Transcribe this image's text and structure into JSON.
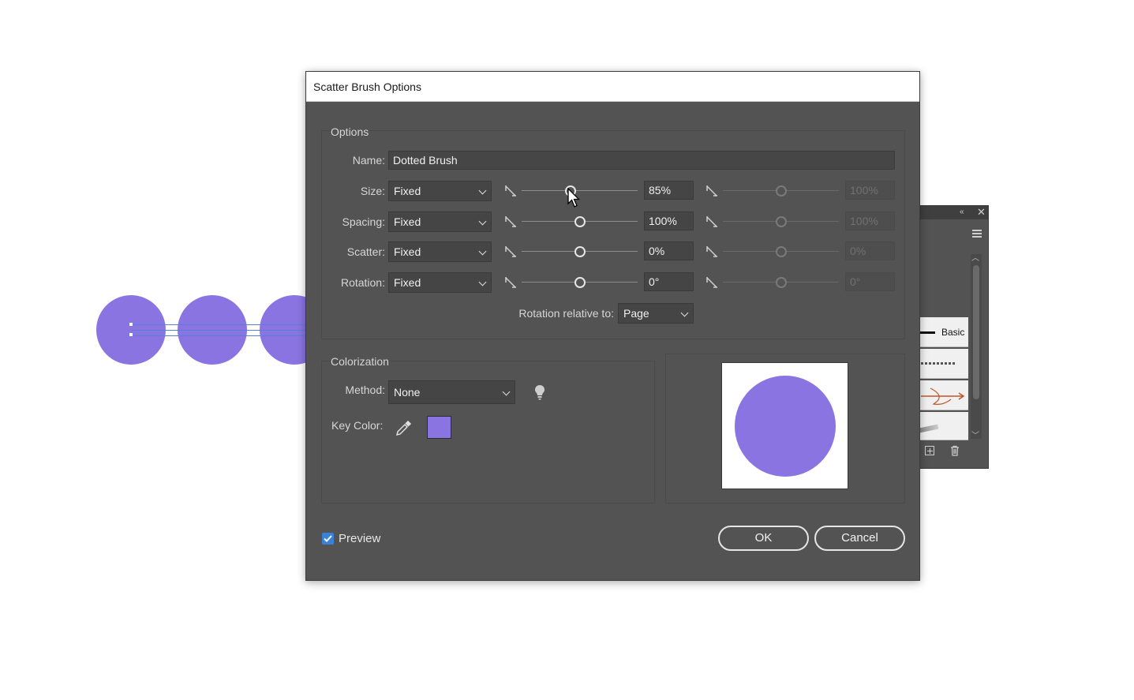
{
  "dialog": {
    "title": "Scatter Brush Options",
    "options_group_label": "Options",
    "name_label": "Name:",
    "name_value": "Dotted Brush",
    "rows": [
      {
        "label": "Size:",
        "mode": "Fixed",
        "value": "85%",
        "value2": "100%",
        "slider_fraction": 0.42
      },
      {
        "label": "Spacing:",
        "mode": "Fixed",
        "value": "100%",
        "value2": "100%",
        "slider_fraction": 0.5
      },
      {
        "label": "Scatter:",
        "mode": "Fixed",
        "value": "0%",
        "value2": "0%",
        "slider_fraction": 0.5
      },
      {
        "label": "Rotation:",
        "mode": "Fixed",
        "value": "0°",
        "value2": "0°",
        "slider_fraction": 0.5
      }
    ],
    "rotation_relative_label": "Rotation relative to:",
    "rotation_relative_value": "Page",
    "colorization_label": "Colorization",
    "method_label": "Method:",
    "method_value": "None",
    "key_color_label": "Key Color:",
    "key_color": "#8a74e2",
    "preview_label": "Preview",
    "preview_checked": true,
    "ok_label": "OK",
    "cancel_label": "Cancel"
  },
  "brushes_panel": {
    "basic_label": "Basic"
  },
  "colors": {
    "dialog_bg": "#535353",
    "artwork": "#8a74e2",
    "accent_check": "#3b82d6"
  }
}
